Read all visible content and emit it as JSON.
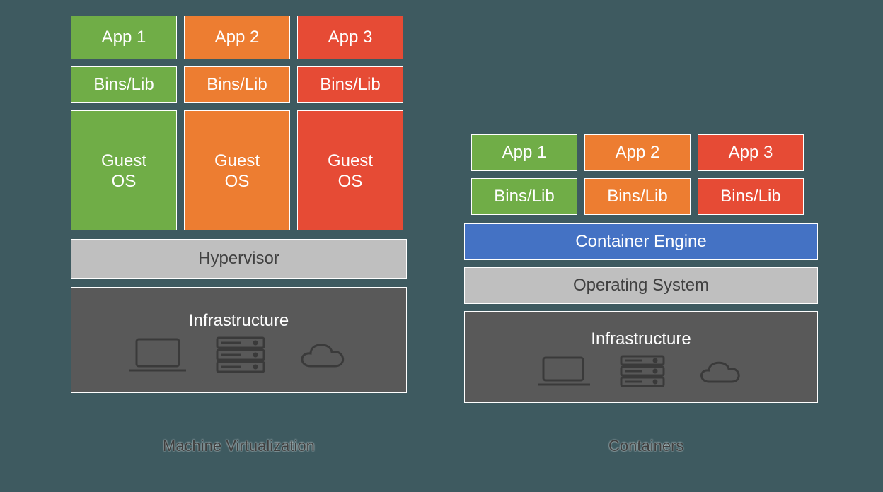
{
  "left": {
    "title": "Machine Virtualization",
    "columns": [
      {
        "app": "App 1",
        "bins": "Bins/Lib",
        "guest": "Guest\nOS",
        "color": "green"
      },
      {
        "app": "App 2",
        "bins": "Bins/Lib",
        "guest": "Guest\nOS",
        "color": "orange"
      },
      {
        "app": "App 3",
        "bins": "Bins/Lib",
        "guest": "Guest\nOS",
        "color": "red"
      }
    ],
    "hypervisor": "Hypervisor",
    "infrastructure": "Infrastructure"
  },
  "right": {
    "title": "Containers",
    "columns": [
      {
        "app": "App 1",
        "bins": "Bins/Lib",
        "color": "green"
      },
      {
        "app": "App 2",
        "bins": "Bins/Lib",
        "color": "orange"
      },
      {
        "app": "App 3",
        "bins": "Bins/Lib",
        "color": "red"
      }
    ],
    "container_engine": "Container Engine",
    "operating_system": "Operating System",
    "infrastructure": "Infrastructure"
  }
}
